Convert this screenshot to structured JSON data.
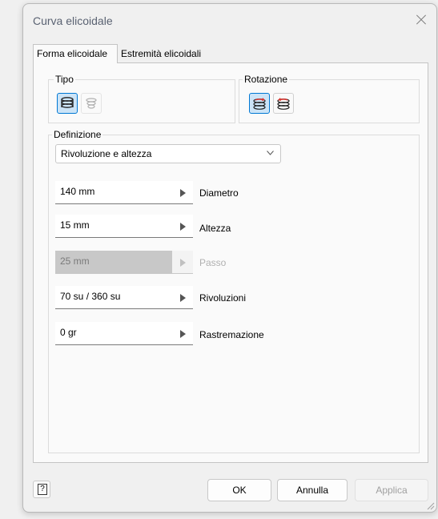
{
  "window": {
    "title": "Curva elicoidale"
  },
  "tabs": [
    {
      "label": "Forma elicoidale",
      "active": true
    },
    {
      "label": "Estremità elicoidali",
      "active": false
    }
  ],
  "tipo": {
    "label": "Tipo",
    "options": [
      {
        "icon": "helix-coil-icon",
        "selected": true
      },
      {
        "icon": "spiral-icon",
        "selected": false,
        "disabled": true
      }
    ]
  },
  "rotazione": {
    "label": "Rotazione",
    "options": [
      {
        "icon": "clockwise-rotation-icon",
        "selected": true
      },
      {
        "icon": "counterclockwise-rotation-icon",
        "selected": false
      }
    ]
  },
  "definizione": {
    "label": "Definizione",
    "method_value": "Rivoluzione e altezza",
    "fields": [
      {
        "value": "140 mm",
        "label": "Diametro",
        "enabled": true
      },
      {
        "value": "15 mm",
        "label": "Altezza",
        "enabled": true
      },
      {
        "value": "25 mm",
        "label": "Passo",
        "enabled": false
      },
      {
        "value": "70 su / 360 su",
        "label": "Rivoluzioni",
        "enabled": true
      },
      {
        "value": "0 gr",
        "label": "Rastremazione",
        "enabled": true
      }
    ]
  },
  "footer": {
    "help_icon": "help-icon",
    "ok_label": "OK",
    "cancel_label": "Annulla",
    "apply_label": "Applica"
  },
  "colors": {
    "accent": "#0078d4",
    "selected_bg": "#cce4f7",
    "rotation_red": "#d9302a"
  }
}
